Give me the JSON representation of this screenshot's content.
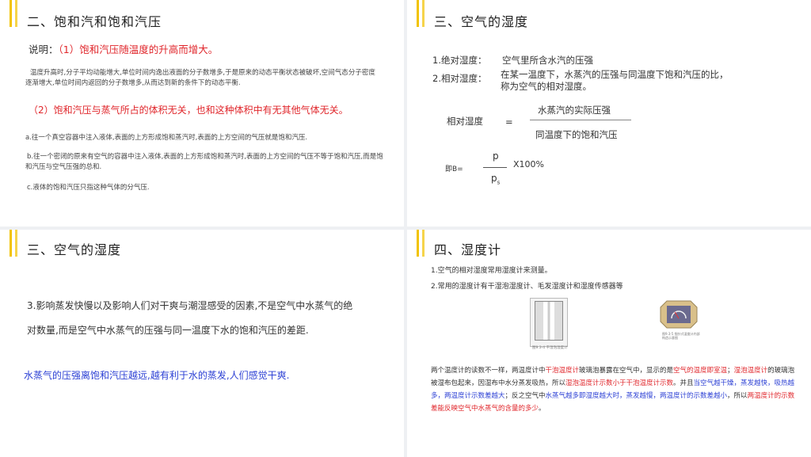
{
  "slide1": {
    "title": "二、饱和汽和饱和汽压",
    "explain_label": "说明：",
    "explain_point1": "（1）饱和汽压随温度的升高而增大。",
    "paragraph": "温度升高时,分子平均动能增大,单位时间内逸出液面的分子数增多,于是原来的动态平衡状态被破坏,空间气态分子密度逐渐增大,单位时间内返回的分子数增多,从而达到新的条件下的动态平衡.",
    "point2": "（2）饱和汽压与蒸气所占的体积无关，也和这种体积中有无其他气体无关。",
    "item_a": "a.往一个真空容器中注入液体,表面的上方形成饱和蒸汽时,表面的上方空间的气压就是饱和汽压.",
    "item_b": "b.往一个密闭的原来有空气的容器中注入液体,表面的上方形成饱和蒸汽时,表面的上方空间的气压不等于饱和汽压,而是饱和汽压与空气压强的总和.",
    "item_c": "c.液体的饱和汽压只指这种气体的分气压."
  },
  "slide2": {
    "title": "三、空气的湿度",
    "abs_label": "1.绝对湿度：",
    "abs_text": "空气里所含水汽的压强",
    "rel_label": "2.相对湿度：",
    "rel_text": "在某一温度下，水蒸汽的压强与同温度下饱和汽压的比，称为空气的相对湿度。",
    "frac_label": "相对湿度",
    "eq": "=",
    "numerator": "水蒸汽的实际压强",
    "denominator": "同温度下的饱和汽压",
    "b_label": "即B=",
    "p": "p",
    "ps_main": "p",
    "ps_sub": "s",
    "times": "X100%"
  },
  "slide3": {
    "title": "三、空气的湿度",
    "line1": "3.影响蒸发快慢以及影响人们对干爽与潮湿感受的因素,不是空气中水蒸气的绝",
    "line2": "对数量,而是空气中水蒸气的压强与同一温度下水的饱和汽压的差距.",
    "blue_line": "水蒸气的压强离饱和汽压越远,越有利于水的蒸发,人们感觉干爽."
  },
  "slide4": {
    "title": "四、湿度计",
    "p1": "1.空气的相对湿度常用湿度计来测量。",
    "p2": "2.常用的湿度计有干湿泡湿度计、毛发湿度计和湿度传感器等",
    "img1_caption": "图9.3-4 干湿泡湿度计",
    "img2_caption": "图9.3-5 指针式湿度计内部构造示意图",
    "desc": [
      {
        "t": "两个温度计的读数不一样，两温度计中",
        "c": ""
      },
      {
        "t": "干泡温度计",
        "c": "red"
      },
      {
        "t": "玻璃泡暴露在空气中，显示的是",
        "c": ""
      },
      {
        "t": "空气的温度即室温",
        "c": "red"
      },
      {
        "t": "；",
        "c": ""
      },
      {
        "t": "湿泡温度计",
        "c": "red"
      },
      {
        "t": "的玻璃泡被湿布包起来，因湿布中水分蒸发吸热，所以",
        "c": ""
      },
      {
        "t": "湿泡温度计示数小于干泡温度计示数",
        "c": "red"
      },
      {
        "t": "。并且",
        "c": ""
      },
      {
        "t": "当空气越干燥，蒸发越快，吸热越多，两温度计示数差越大",
        "c": "blue"
      },
      {
        "t": "；反之空气中",
        "c": ""
      },
      {
        "t": "水蒸气越多即湿度越大时，蒸发越慢，两温度计的示数差越小",
        "c": "blue"
      },
      {
        "t": "，所以",
        "c": ""
      },
      {
        "t": "两温度计的示数差能反映空气中水蒸气的含量的多少",
        "c": "red"
      },
      {
        "t": "。",
        "c": ""
      }
    ]
  },
  "colors": {
    "accent": "#f2c300",
    "red": "#e0262b",
    "blue": "#2b3fd4"
  }
}
